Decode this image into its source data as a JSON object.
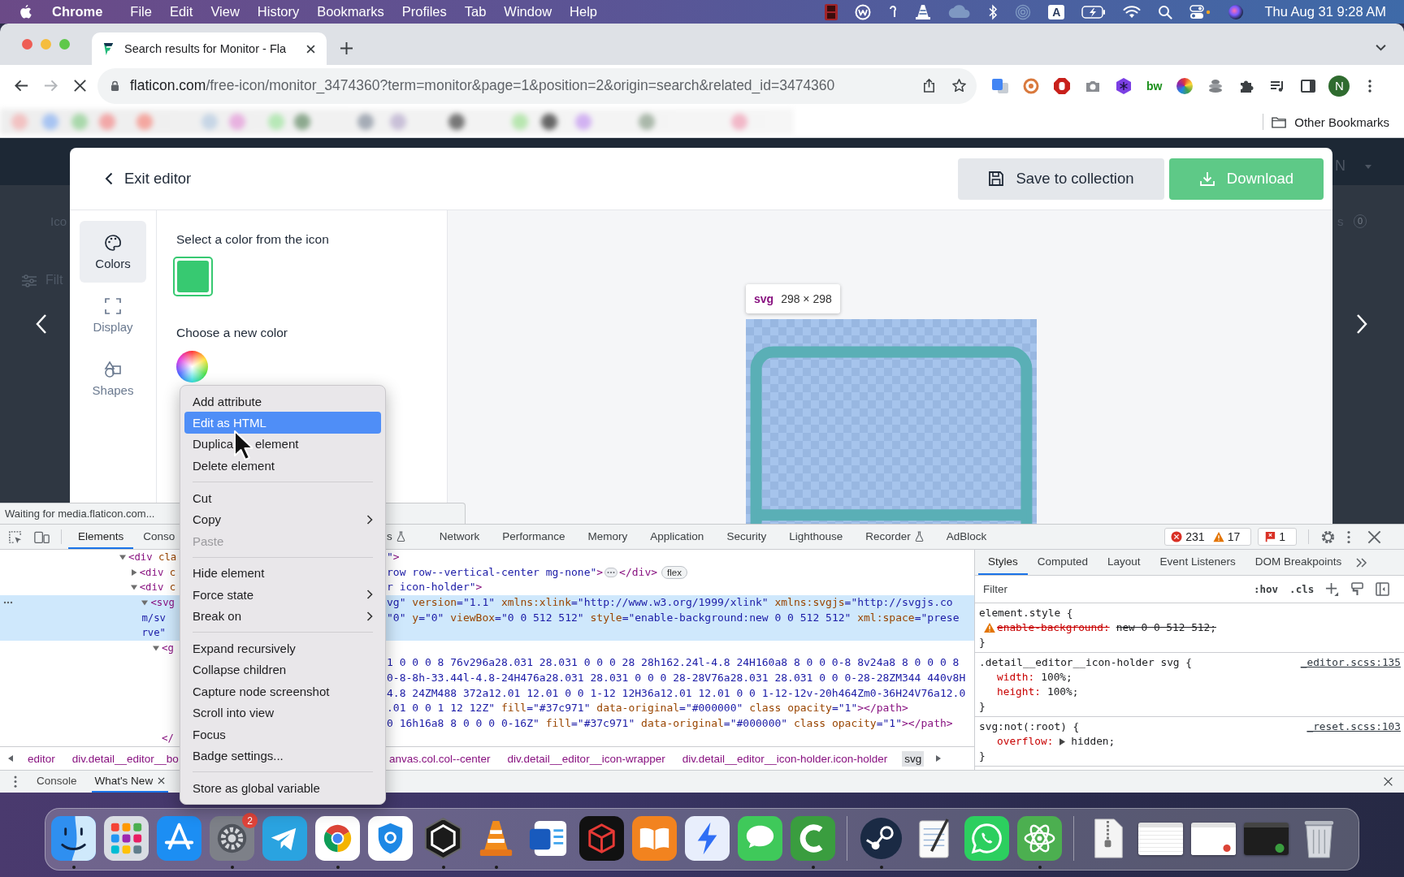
{
  "menu_bar": {
    "app_name": "Chrome",
    "items": [
      "File",
      "Edit",
      "View",
      "History",
      "Bookmarks",
      "Profiles",
      "Tab",
      "Window",
      "Help"
    ],
    "input_source": "A",
    "clock": "Thu Aug 31 9:28 AM"
  },
  "browser": {
    "tabs": [
      {
        "title": "Search results for Monitor - Fla",
        "selected": true
      }
    ],
    "loading": true,
    "url_host": "flaticon.com",
    "url_path": "/free-icon/monitor_3474360?term=monitor&page=1&position=2&origin=search&related_id=3474360",
    "extension_label": "bw",
    "profile_initial": "N",
    "other_bookmarks": "Other Bookmarks",
    "status": "Waiting for media.flaticon.com..."
  },
  "backdrop": {
    "category_label": "Ico",
    "filter_label": "Filt",
    "avatar_initial": "N",
    "right_label": "s",
    "right_count": "0"
  },
  "editor": {
    "exit_label": "Exit editor",
    "save_label": "Save to collection",
    "download_label": "Download",
    "rail": [
      {
        "label": "Colors",
        "kind": "palette",
        "selected": true
      },
      {
        "label": "Display",
        "kind": "frame",
        "selected": false
      },
      {
        "label": "Shapes",
        "kind": "shapes",
        "selected": false
      }
    ],
    "pick_title": "Select a color from the icon",
    "icon_colors": [
      {
        "color": "#37c971",
        "selected": true
      }
    ],
    "new_color_title": "Choose a new color",
    "inspect_tag": "svg",
    "inspect_size": "298 × 298"
  },
  "context_menu": [
    {
      "kind": "item",
      "label": "Add attribute",
      "selected": false,
      "disabled": false,
      "submenu": false
    },
    {
      "kind": "item",
      "label": "Edit as HTML",
      "selected": true,
      "disabled": false,
      "submenu": false
    },
    {
      "kind": "item",
      "label_parts": [
        "Duplica",
        "element"
      ],
      "selected": false,
      "disabled": false,
      "submenu": false
    },
    {
      "kind": "item",
      "label": "Delete element",
      "selected": false,
      "disabled": false,
      "submenu": false
    },
    {
      "kind": "separator"
    },
    {
      "kind": "item",
      "label": "Cut",
      "selected": false,
      "disabled": false,
      "submenu": false
    },
    {
      "kind": "item",
      "label": "Copy",
      "selected": false,
      "disabled": false,
      "submenu": true
    },
    {
      "kind": "item",
      "label": "Paste",
      "selected": false,
      "disabled": true,
      "submenu": false
    },
    {
      "kind": "separator"
    },
    {
      "kind": "item",
      "label": "Hide element",
      "selected": false,
      "disabled": false,
      "submenu": false
    },
    {
      "kind": "item",
      "label": "Force state",
      "selected": false,
      "disabled": false,
      "submenu": true
    },
    {
      "kind": "item",
      "label": "Break on",
      "selected": false,
      "disabled": false,
      "submenu": true
    },
    {
      "kind": "separator"
    },
    {
      "kind": "item",
      "label": "Expand recursively",
      "selected": false,
      "disabled": false,
      "submenu": false
    },
    {
      "kind": "item",
      "label": "Collapse children",
      "selected": false,
      "disabled": false,
      "submenu": false
    },
    {
      "kind": "item",
      "label": "Capture node screenshot",
      "selected": false,
      "disabled": false,
      "submenu": false
    },
    {
      "kind": "item",
      "label": "Scroll into view",
      "selected": false,
      "disabled": false,
      "submenu": false
    },
    {
      "kind": "item",
      "label": "Focus",
      "selected": false,
      "disabled": false,
      "submenu": false
    },
    {
      "kind": "item",
      "label": "Badge settings...",
      "selected": false,
      "disabled": false,
      "submenu": false
    },
    {
      "kind": "separator"
    },
    {
      "kind": "item",
      "label": "Store as global variable",
      "selected": false,
      "disabled": false,
      "submenu": false
    }
  ],
  "devtools": {
    "tabs_left": [
      {
        "label": "Elements",
        "selected": true,
        "experimental": false
      },
      {
        "label": "Conso",
        "selected": false,
        "experimental": false
      }
    ],
    "tabs_right": [
      {
        "label": "s",
        "selected": false,
        "experimental": true
      },
      {
        "label": "Network",
        "selected": false,
        "experimental": false
      },
      {
        "label": "Performance",
        "selected": false,
        "experimental": false
      },
      {
        "label": "Memory",
        "selected": false,
        "experimental": false
      },
      {
        "label": "Application",
        "selected": false,
        "experimental": false
      },
      {
        "label": "Security",
        "selected": false,
        "experimental": false
      },
      {
        "label": "Lighthouse",
        "selected": false,
        "experimental": false
      },
      {
        "label": "Recorder",
        "selected": false,
        "experimental": true
      },
      {
        "label": "AdBlock",
        "selected": false,
        "experimental": false
      }
    ],
    "error_count": "231",
    "warning_count": "17",
    "issue_count": "1",
    "dom_tree": [
      {
        "expanded": true,
        "selected": false,
        "lines": [
          {
            "left": [
              {
                "kind": "tag",
                "text": "<div"
              },
              {
                "kind": "attr",
                "text": " cla"
              }
            ],
            "right": [
              {
                "kind": "value",
                "text": "\""
              },
              {
                "kind": "tag",
                "text": ">"
              }
            ]
          }
        ],
        "children": [
          {
            "expanded": false,
            "selected": false,
            "lines": [
              {
                "left": [
                  {
                    "kind": "tag",
                    "text": "<div"
                  },
                  {
                    "kind": "attr",
                    "text": " c"
                  }
                ],
                "right": [
                  {
                    "kind": "value",
                    "text": "row row--vertical-center mg-none\""
                  },
                  {
                    "kind": "tag",
                    "text": ">"
                  }
                ],
                "ellipsis": true,
                "after": [
                  {
                    "kind": "tag",
                    "text": "</div>"
                  }
                ],
                "badge": "flex"
              }
            ]
          },
          {
            "expanded": true,
            "selected": false,
            "lines": [
              {
                "left": [
                  {
                    "kind": "tag",
                    "text": "<div"
                  },
                  {
                    "kind": "attr",
                    "text": " c"
                  }
                ],
                "right": [
                  {
                    "kind": "value",
                    "text": "r icon-holder\""
                  },
                  {
                    "kind": "tag",
                    "text": ">"
                  }
                ]
              }
            ],
            "children": [
              {
                "expanded": true,
                "selected": true,
                "lines": [
                  {
                    "left": [
                      {
                        "kind": "tag",
                        "text": "<svg"
                      }
                    ],
                    "right": [
                      {
                        "kind": "value",
                        "text": "vg\""
                      },
                      {
                        "kind": "attr",
                        "text": " version"
                      },
                      {
                        "kind": "value",
                        "text": "=\"1.1\""
                      },
                      {
                        "kind": "attr",
                        "text": " xmlns:xlink"
                      },
                      {
                        "kind": "value",
                        "text": "=\"http://www.w3.org/1999/xlink\""
                      },
                      {
                        "kind": "attr",
                        "text": " xmlns:svgjs"
                      },
                      {
                        "kind": "value",
                        "text": "=\"http://svgjs.co"
                      }
                    ]
                  },
                  {
                    "left": [
                      {
                        "kind": "value",
                        "text": "m/sv"
                      }
                    ],
                    "right": [
                      {
                        "kind": "value",
                        "text": "\"0\""
                      },
                      {
                        "kind": "attr",
                        "text": " y"
                      },
                      {
                        "kind": "value",
                        "text": "=\"0\""
                      },
                      {
                        "kind": "attr",
                        "text": " viewBox"
                      },
                      {
                        "kind": "value",
                        "text": "=\"0 0 512 512\""
                      },
                      {
                        "kind": "attr",
                        "text": " style"
                      },
                      {
                        "kind": "value",
                        "text": "=\"enable-background:new 0 0 512 512\""
                      },
                      {
                        "kind": "attr",
                        "text": " xml:space"
                      },
                      {
                        "kind": "value",
                        "text": "=\"prese"
                      }
                    ]
                  },
                  {
                    "left": [
                      {
                        "kind": "value",
                        "text": "rve\""
                      }
                    ]
                  }
                ],
                "children": [
                  {
                    "expanded": true,
                    "selected": false,
                    "lines": [
                      {
                        "left": [
                          {
                            "kind": "tag",
                            "text": "<g"
                          }
                        ]
                      }
                    ],
                    "close": [
                      {
                        "kind": "tag",
                        "text": "</"
                      }
                    ],
                    "children": [
                      {
                        "selected": false,
                        "lines": [
                          {
                            "right": [
                              {
                                "kind": "value",
                                "text": "1 0 0 0 8 76v296a28.031 28.031 0 0 0 28 28h162.24l-4.8 24H160a8 8 0 0 0-8 8v24a8 8 0 0 0 8"
                              }
                            ]
                          },
                          {
                            "right": [
                              {
                                "kind": "value",
                                "text": "0-8-8h-33.44l-4.8-24H476a28.031 28.031 0 0 0 28-28V76a28.031 28.031 0 0 0-28-28ZM344 440v8H"
                              }
                            ]
                          },
                          {
                            "right": [
                              {
                                "kind": "value",
                                "text": "4.8 24ZM488 372a12.01 12.01 0 0 1-12 12H36a12.01 12.01 0 0 1-12-12v-20h464Zm0-36H24V76a12.0"
                              }
                            ]
                          },
                          {
                            "right": [
                              {
                                "kind": "value",
                                "text": ".01 0 0 1 12 12Z\""
                              },
                              {
                                "kind": "attr",
                                "text": " fill"
                              },
                              {
                                "kind": "value",
                                "text": "=\"#37c971\""
                              },
                              {
                                "kind": "attr",
                                "text": " data-original"
                              },
                              {
                                "kind": "value",
                                "text": "=\"#000000\""
                              },
                              {
                                "kind": "attr",
                                "text": " class opacity"
                              },
                              {
                                "kind": "value",
                                "text": "=\"1\""
                              },
                              {
                                "kind": "tag",
                                "text": "></path>"
                              }
                            ]
                          }
                        ]
                      },
                      {
                        "selected": false,
                        "lines": [
                          {
                            "right": [
                              {
                                "kind": "value",
                                "text": "0 16h16a8 8 0 0 0 0-16Z\""
                              },
                              {
                                "kind": "attr",
                                "text": " fill"
                              },
                              {
                                "kind": "value",
                                "text": "=\"#37c971\""
                              },
                              {
                                "kind": "attr",
                                "text": " data-original"
                              },
                              {
                                "kind": "value",
                                "text": "=\"#000000\""
                              },
                              {
                                "kind": "attr",
                                "text": " class opacity"
                              },
                              {
                                "kind": "value",
                                "text": "=\"1\""
                              },
                              {
                                "kind": "tag",
                                "text": "></path>"
                              }
                            ]
                          }
                        ]
                      }
                    ]
                  }
                ]
              }
            ]
          }
        ]
      }
    ],
    "breadcrumbs_left": [
      {
        "label": "editor",
        "selected": false
      },
      {
        "label": "div.detail__editor__bo",
        "selected": false
      }
    ],
    "breadcrumbs_right": [
      {
        "label": "anvas.col.col--center",
        "selected": false
      },
      {
        "label": "div.detail__editor__icon-wrapper",
        "selected": false
      },
      {
        "label": "div.detail__editor__icon-holder.icon-holder",
        "selected": false
      },
      {
        "label": "svg",
        "selected": true
      }
    ],
    "styles_tabs": [
      {
        "label": "Styles",
        "selected": true
      },
      {
        "label": "Computed",
        "selected": false
      },
      {
        "label": "Layout",
        "selected": false
      },
      {
        "label": "Event Listeners",
        "selected": false
      },
      {
        "label": "DOM Breakpoints",
        "selected": false
      }
    ],
    "filter_placeholder": "Filter",
    "hover_toggle": ":hov",
    "class_toggle": ".cls",
    "style_rules": [
      {
        "selector": "element.style {",
        "declarations": [
          {
            "property": "enable-background:",
            "value": "new 0 0 512 512;",
            "overridden": true,
            "warning": true,
            "expandable": false
          }
        ],
        "close": "}"
      },
      {
        "selector": ".detail__editor__icon-holder svg {",
        "source": "_editor.scss:135",
        "declarations": [
          {
            "property": "width:",
            "value": "100%;",
            "overridden": false,
            "warning": false,
            "expandable": false
          },
          {
            "property": "height:",
            "value": "100%;",
            "overridden": false,
            "warning": false,
            "expandable": false
          }
        ],
        "close": "}"
      },
      {
        "selector": "svg:not(:root) {",
        "source": "_reset.scss:103",
        "declarations": [
          {
            "property": "overflow:",
            "value": "hidden;",
            "overridden": false,
            "warning": false,
            "expandable": true
          }
        ],
        "close": "}"
      }
    ],
    "drawer_tabs": [
      {
        "label": "Console",
        "selected": false,
        "closable": false
      },
      {
        "label": "What's New",
        "selected": true,
        "closable": true
      }
    ]
  },
  "dock": [
    {
      "kind": "face",
      "running": true
    },
    {
      "kind": "grid",
      "running": false
    },
    {
      "kind": "store",
      "running": false
    },
    {
      "kind": "gear",
      "running": true,
      "badge": "2"
    },
    {
      "kind": "plane",
      "running": false
    },
    {
      "kind": "ring",
      "running": true
    },
    {
      "kind": "shield",
      "running": false
    },
    {
      "kind": "hexagon",
      "running": true
    },
    {
      "kind": "cone",
      "running": true
    },
    {
      "kind": "document",
      "running": false
    },
    {
      "kind": "cube",
      "running": false
    },
    {
      "kind": "book",
      "running": false
    },
    {
      "kind": "bolt",
      "running": false
    },
    {
      "kind": "bubble",
      "running": false
    },
    {
      "kind": "arc",
      "running": true
    },
    {
      "kind": "separator"
    },
    {
      "kind": "linkage",
      "running": true
    },
    {
      "kind": "notepad",
      "running": false
    },
    {
      "kind": "phone",
      "running": false
    },
    {
      "kind": "atom",
      "running": true
    },
    {
      "kind": "separator"
    },
    {
      "kind": "archive",
      "running": false
    },
    {
      "kind": "window",
      "running": false
    },
    {
      "kind": "webwindow",
      "running": false
    },
    {
      "kind": "darkwindow",
      "running": false
    },
    {
      "kind": "trash",
      "running": false
    }
  ]
}
